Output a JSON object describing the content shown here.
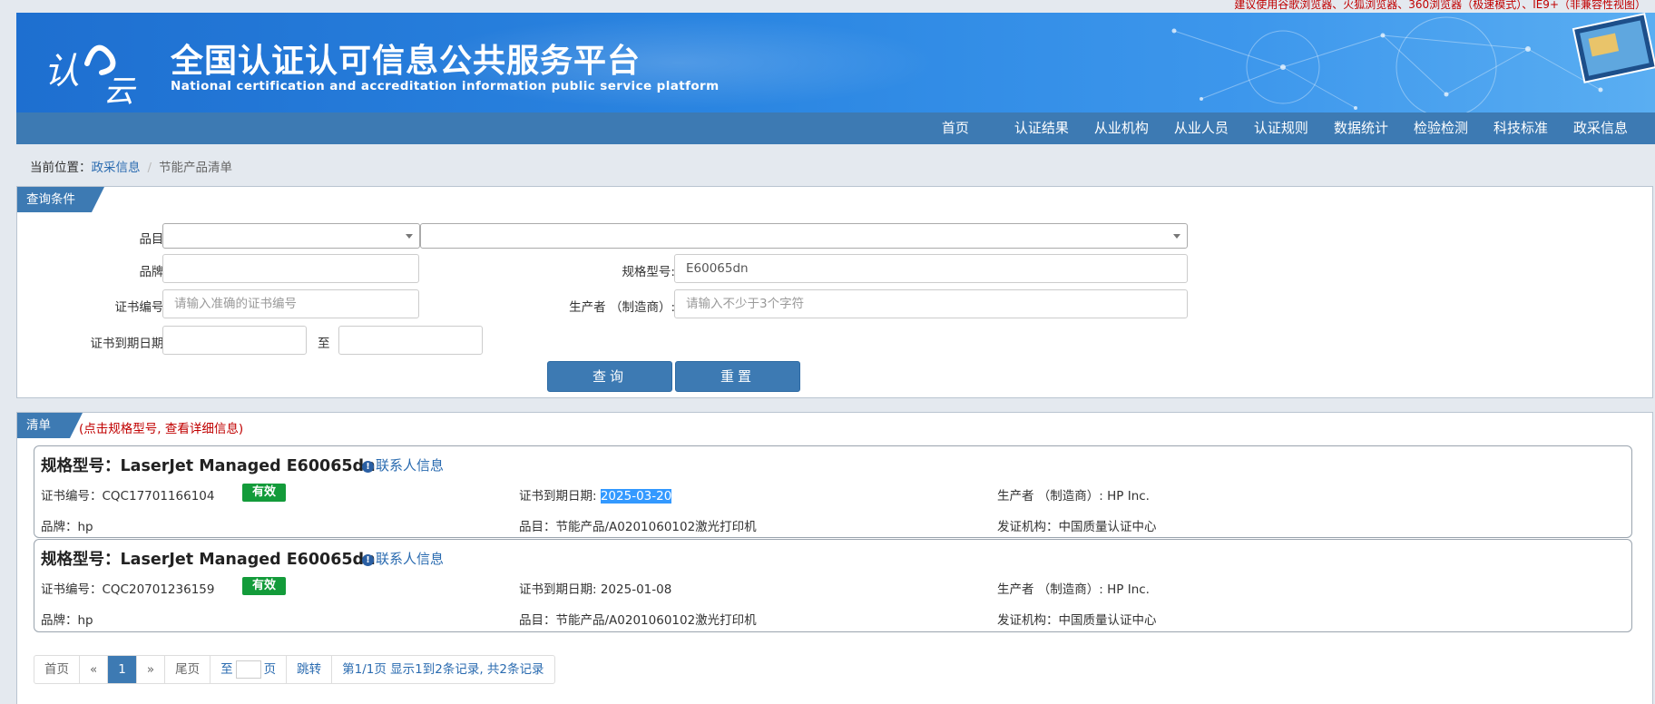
{
  "browser_tip": "建议使用谷歌浏览器、火狐浏览器、360浏览器（极速模式）、IE9+（非兼容性视图）",
  "header": {
    "title": "全国认证认可信息公共服务平台",
    "subtitle": "National certification and accreditation information public service platform",
    "logo_text": "认云"
  },
  "nav": [
    "首页",
    "认证结果",
    "从业机构",
    "从业人员",
    "认证规则",
    "数据统计",
    "检验检测",
    "科技标准",
    "政采信息"
  ],
  "breadcrumb": {
    "label": "当前位置：",
    "link": "政采信息",
    "separator": "/",
    "current": "节能产品清单"
  },
  "query": {
    "tab": "查询条件",
    "category_label": "品目:",
    "brand_label": "品牌:",
    "brand_value": "",
    "model_label": "规格型号:",
    "model_value": "E60065dn",
    "cert_no_label": "证书编号:",
    "cert_no_placeholder": "请输入准确的证书编号",
    "maker_label": "生产者 （制造商）:",
    "maker_placeholder": "请输入不少于3个字符",
    "expiry_label": "证书到期日期:",
    "to_label": "至",
    "search_button": "查询",
    "reset_button": "重置"
  },
  "list": {
    "tab": "清单",
    "note": "(点击规格型号, 查看详细信息)",
    "items": [
      {
        "title": "规格型号：LaserJet Managed E60065dn",
        "contact": "联系人信息",
        "cert_no": "证书编号：CQC17701166104",
        "status": "有效",
        "expiry_label": "证书到期日期: ",
        "expiry_date": "2025-03-20",
        "maker": "生产者 （制造商）: HP Inc.",
        "brand": "品牌：hp",
        "category": "品目：节能产品/A0201060102激光打印机",
        "issuer": "发证机构：中国质量认证中心"
      },
      {
        "title": "规格型号：LaserJet Managed E60065dn",
        "contact": "联系人信息",
        "cert_no": "证书编号：CQC20701236159",
        "status": "有效",
        "expiry_label": "证书到期日期: ",
        "expiry_date": "2025-01-08",
        "maker": "生产者 （制造商）: HP Inc.",
        "brand": "品牌：hp",
        "category": "品目：节能产品/A0201060102激光打印机",
        "issuer": "发证机构：中国质量认证中心"
      }
    ]
  },
  "pagination": {
    "first": "首页",
    "prev": "«",
    "current": "1",
    "next": "»",
    "last": "尾页",
    "goto_prefix": "至",
    "goto_suffix": "页",
    "jump": "跳转",
    "summary": "第1/1页  显示1到2条记录, 共2条记录"
  }
}
